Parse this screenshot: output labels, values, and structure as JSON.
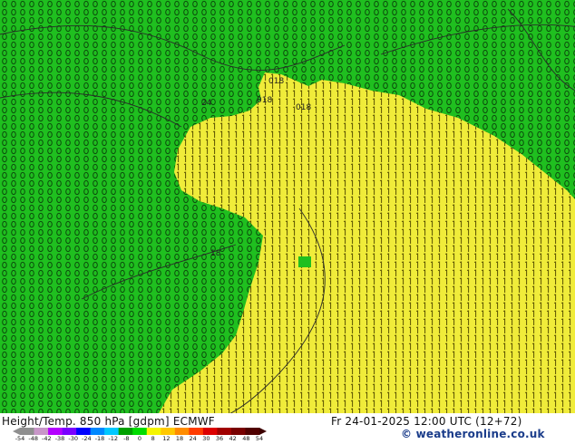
{
  "map": {
    "colors": {
      "green": "#1fbf1f",
      "green_text": "#0b4d0b",
      "yellow": "#f0ec3a",
      "yellow_text": "#5a5200",
      "contour": "#2a2a2a"
    },
    "contour_labels": [
      "018",
      "018",
      "018",
      "24",
      "18"
    ]
  },
  "footer": {
    "title": "Height/Temp. 850 hPa [gdpm] ECMWF",
    "model": "",
    "valid": "Fr 24-01-2025 12:00 UTC (12+72)",
    "credit": "© weatheronline.co.uk"
  },
  "colorbar": {
    "ticks": [
      "-54",
      "-48",
      "-42",
      "-38",
      "-30",
      "-24",
      "-18",
      "-12",
      "-8",
      "0",
      "8",
      "12",
      "18",
      "24",
      "30",
      "36",
      "42",
      "48",
      "54"
    ],
    "colors": [
      "#8f8f8f",
      "#c896c8",
      "#b400ff",
      "#7a00ff",
      "#0000ff",
      "#0088ff",
      "#00c8ff",
      "#00a000",
      "#00dc00",
      "#f5f500",
      "#ffc800",
      "#ff8c00",
      "#ff3c00",
      "#dc0000",
      "#a00000",
      "#780000",
      "#500000"
    ]
  }
}
